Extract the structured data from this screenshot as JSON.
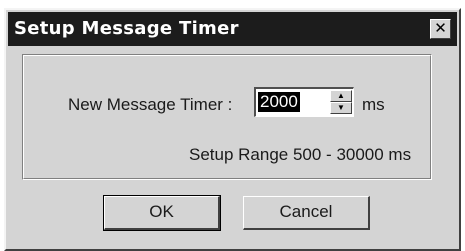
{
  "window": {
    "title": "Setup Message Timer",
    "close_label": "✕"
  },
  "form": {
    "timer_label": "New Message Timer :",
    "timer_value": "2000",
    "unit": "ms",
    "range_text": "Setup Range 500 - 30000 ms",
    "spin_up_icon": "arrow-up-icon",
    "spin_down_icon": "arrow-down-icon"
  },
  "buttons": {
    "ok_label": "OK",
    "cancel_label": "Cancel"
  },
  "colors": {
    "titlebar": "#1c1c1c",
    "dialog_face": "#d4d4d4"
  }
}
